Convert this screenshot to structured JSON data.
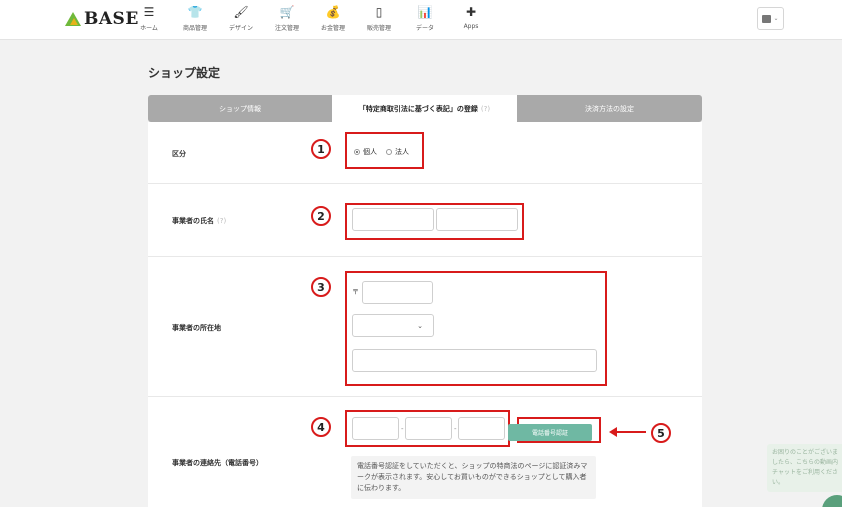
{
  "app": {
    "logo_text": "BASE"
  },
  "nav": [
    {
      "label": "ホーム",
      "icon": "☰",
      "name": "nav-home"
    },
    {
      "label": "商品管理",
      "icon": "👕",
      "name": "nav-items"
    },
    {
      "label": "デザイン",
      "icon": "🖌",
      "name": "nav-design"
    },
    {
      "label": "注文管理",
      "icon": "🛒",
      "name": "nav-orders"
    },
    {
      "label": "お金管理",
      "icon": "💰",
      "name": "nav-money"
    },
    {
      "label": "販売管理",
      "icon": "▯",
      "name": "nav-sales"
    },
    {
      "label": "データ",
      "icon": "📊",
      "name": "nav-data"
    },
    {
      "label": "Apps",
      "icon": "✚",
      "name": "nav-apps"
    }
  ],
  "page": {
    "title": "ショップ設定"
  },
  "tabs": {
    "shop_info": "ショップ情報",
    "tokushoho": "「特定商取引法に基づく表記」の登録",
    "tokushoho_hint": "(?)",
    "payment": "決済方法の設定"
  },
  "form": {
    "category": {
      "label": "区分",
      "options": [
        "個人",
        "法人"
      ],
      "selected": "個人"
    },
    "name": {
      "label": "事業者の氏名",
      "hint": "(?)",
      "last_name": "",
      "first_name": ""
    },
    "address": {
      "label": "事業者の所在地",
      "postal_mark": "〒",
      "postal_code": "",
      "prefecture": "",
      "address_line": ""
    },
    "phone": {
      "label": "事業者の連絡先（電話番号）",
      "part1": "",
      "part2": "",
      "part3": "",
      "separator": "-",
      "verify_button": "電話番号認証",
      "info": "電話番号認証をしていただくと、ショップの特商法のページに認証済みマークが表示されます。安心してお買いものができるショップとして購入者に伝わります。"
    }
  },
  "annotations": [
    "1",
    "2",
    "3",
    "4",
    "5"
  ],
  "chat": {
    "text": "お困りのことがございましたら、こちらの動画内チャットをご利用ください。"
  },
  "colors": {
    "accent": "#6fb8a3",
    "highlight": "#d81b1b",
    "tab_inactive": "#a9a9a9"
  }
}
